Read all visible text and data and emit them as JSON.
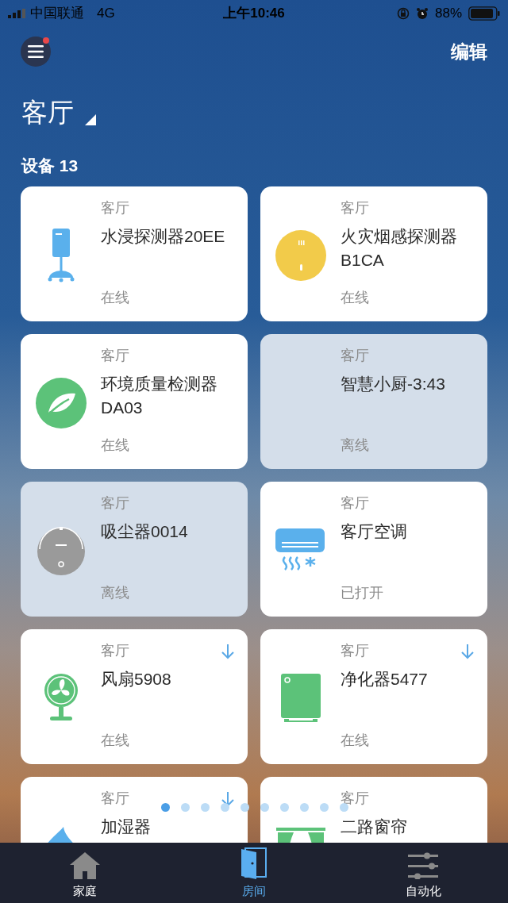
{
  "status_bar": {
    "carrier": "中国联通",
    "network": "4G",
    "time": "上午10:46",
    "battery": "88%"
  },
  "header": {
    "menu_badge": true,
    "edit": "编辑"
  },
  "room": {
    "title": "客厅"
  },
  "devices_heading": "设备 13",
  "devices": [
    {
      "kind": "water-sensor",
      "room": "客厅",
      "name": "水浸探测器20EE",
      "status": "在线",
      "online": true,
      "download": false
    },
    {
      "kind": "smoke-sensor",
      "room": "客厅",
      "name": "火灾烟感探测器B1CA",
      "status": "在线",
      "online": true,
      "download": false
    },
    {
      "kind": "leaf",
      "room": "客厅",
      "name": "环境质量检测器DA03",
      "status": "在线",
      "online": true,
      "download": false
    },
    {
      "room": "客厅",
      "name": "智慧小厨-3:43",
      "status": "离线",
      "online": false,
      "download": false
    },
    {
      "kind": "vacuum",
      "room": "客厅",
      "name": "吸尘器0014",
      "status": "离线",
      "online": false,
      "download": false
    },
    {
      "kind": "air-conditioner",
      "room": "客厅",
      "name": "客厅空调",
      "status": "已打开",
      "online": true,
      "download": false
    },
    {
      "kind": "fan",
      "room": "客厅",
      "name": "风扇5908",
      "status": "在线",
      "online": true,
      "download": true
    },
    {
      "kind": "purifier",
      "room": "客厅",
      "name": "净化器5477",
      "status": "在线",
      "online": true,
      "download": true
    },
    {
      "kind": "droplet",
      "room": "客厅",
      "name": "加湿器",
      "online": true,
      "download": true
    },
    {
      "kind": "curtain",
      "room": "客厅",
      "name": "二路窗帘",
      "online": true,
      "download": false
    }
  ],
  "page_dots": [
    {
      "selected": true
    },
    {
      "selected": false
    },
    {
      "selected": false
    },
    {
      "selected": false
    },
    {
      "selected": false
    },
    {
      "selected": false
    },
    {
      "selected": false
    },
    {
      "selected": false
    },
    {
      "selected": false
    },
    {
      "selected": false
    }
  ],
  "tabs": [
    {
      "kind": "home",
      "label": "家庭",
      "selected": false
    },
    {
      "kind": "door",
      "label": "房间",
      "selected": true
    },
    {
      "kind": "sliders",
      "label": "自动化",
      "selected": false
    }
  ]
}
